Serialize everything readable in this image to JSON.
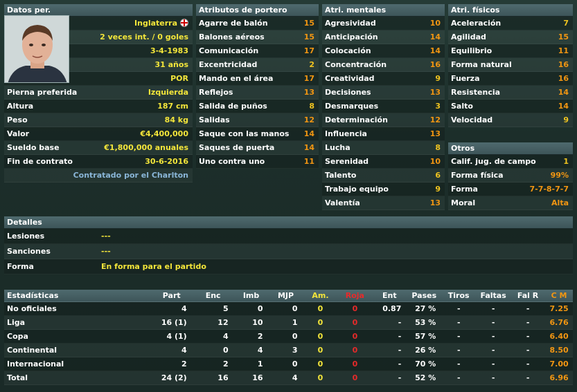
{
  "personal": {
    "header": "Datos per.",
    "country": "Inglaterra",
    "caps": "2 veces int. / 0 goles",
    "dob": "3-4-1983",
    "age": "31 años",
    "position": "POR",
    "rows": [
      {
        "label": "Pierna preferida",
        "value": "Izquierda"
      },
      {
        "label": "Altura",
        "value": "187 cm"
      },
      {
        "label": "Peso",
        "value": "84 kg"
      },
      {
        "label": "Valor",
        "value": "€4,400,000"
      },
      {
        "label": "Sueldo base",
        "value": "€1,800,000 anuales"
      },
      {
        "label": "Fin de contrato",
        "value": "30-6-2016"
      }
    ],
    "contract_note": "Contratado por el Charlton"
  },
  "goalkeeping": {
    "header": "Atributos de portero",
    "rows": [
      {
        "label": "Agarre de balón",
        "value": "15"
      },
      {
        "label": "Balones aéreos",
        "value": "15"
      },
      {
        "label": "Comunicación",
        "value": "17"
      },
      {
        "label": "Excentricidad",
        "value": "2"
      },
      {
        "label": "Mando en el área",
        "value": "17"
      },
      {
        "label": "Reflejos",
        "value": "13"
      },
      {
        "label": "Salida de puños",
        "value": "8"
      },
      {
        "label": "Salidas",
        "value": "12"
      },
      {
        "label": "Saque con las manos",
        "value": "14"
      },
      {
        "label": "Saques de puerta",
        "value": "14"
      },
      {
        "label": "Uno contra uno",
        "value": "11"
      }
    ]
  },
  "mental": {
    "header": "Atri. mentales",
    "rows": [
      {
        "label": "Agresividad",
        "value": "10"
      },
      {
        "label": "Anticipación",
        "value": "14"
      },
      {
        "label": "Colocación",
        "value": "14"
      },
      {
        "label": "Concentración",
        "value": "16"
      },
      {
        "label": "Creatividad",
        "value": "9"
      },
      {
        "label": "Decisiones",
        "value": "13"
      },
      {
        "label": "Desmarques",
        "value": "3"
      },
      {
        "label": "Determinación",
        "value": "12"
      },
      {
        "label": "Influencia",
        "value": "13"
      },
      {
        "label": "Lucha",
        "value": "8"
      },
      {
        "label": "Serenidad",
        "value": "10"
      },
      {
        "label": "Talento",
        "value": "6"
      },
      {
        "label": "Trabajo equipo",
        "value": "9"
      },
      {
        "label": "Valentía",
        "value": "13"
      }
    ]
  },
  "physical": {
    "header": "Atri. físicos",
    "rows": [
      {
        "label": "Aceleración",
        "value": "7"
      },
      {
        "label": "Agilidad",
        "value": "15"
      },
      {
        "label": "Equilibrio",
        "value": "11"
      },
      {
        "label": "Forma natural",
        "value": "16"
      },
      {
        "label": "Fuerza",
        "value": "16"
      },
      {
        "label": "Resistencia",
        "value": "14"
      },
      {
        "label": "Salto",
        "value": "14"
      },
      {
        "label": "Velocidad",
        "value": "9"
      }
    ]
  },
  "others": {
    "header": "Otros",
    "rows": [
      {
        "label": "Calif. jug. de campo",
        "value": "1"
      },
      {
        "label": "Forma física",
        "value": "99%"
      },
      {
        "label": "Forma",
        "value": "7-7-8-7-7"
      },
      {
        "label": "Moral",
        "value": "Alta"
      }
    ]
  },
  "details": {
    "header": "Detalles",
    "rows": [
      {
        "label": "Lesiones",
        "value": "---"
      },
      {
        "label": "Sanciones",
        "value": "---"
      },
      {
        "label": "Forma",
        "value": "En forma para el partido"
      }
    ]
  },
  "stats": {
    "columns": [
      "Estadísticas",
      "Part",
      "Enc",
      "Imb",
      "MJP",
      "Am.",
      "Roja",
      "Ent",
      "Pases",
      "Tiros",
      "Faltas",
      "Fal R",
      "C M"
    ],
    "rows": [
      [
        "No oficiales",
        "4",
        "5",
        "0",
        "0",
        "0",
        "0",
        "0.87",
        "27 %",
        "-",
        "-",
        "-",
        "7.25"
      ],
      [
        "Liga",
        "16 (1)",
        "12",
        "10",
        "1",
        "0",
        "0",
        "-",
        "53 %",
        "-",
        "-",
        "-",
        "6.76"
      ],
      [
        "Copa",
        "4 (1)",
        "4",
        "2",
        "0",
        "0",
        "0",
        "-",
        "57 %",
        "-",
        "-",
        "-",
        "6.40"
      ],
      [
        "Continental",
        "4",
        "0",
        "4",
        "3",
        "0",
        "0",
        "-",
        "26 %",
        "-",
        "-",
        "-",
        "8.50"
      ],
      [
        "Internacional",
        "2",
        "2",
        "1",
        "0",
        "0",
        "0",
        "-",
        "70 %",
        "-",
        "-",
        "-",
        "7.00"
      ],
      [
        "Total",
        "24 (2)",
        "16",
        "16",
        "4",
        "0",
        "0",
        "-",
        "52 %",
        "-",
        "-",
        "-",
        "6.96"
      ]
    ]
  }
}
